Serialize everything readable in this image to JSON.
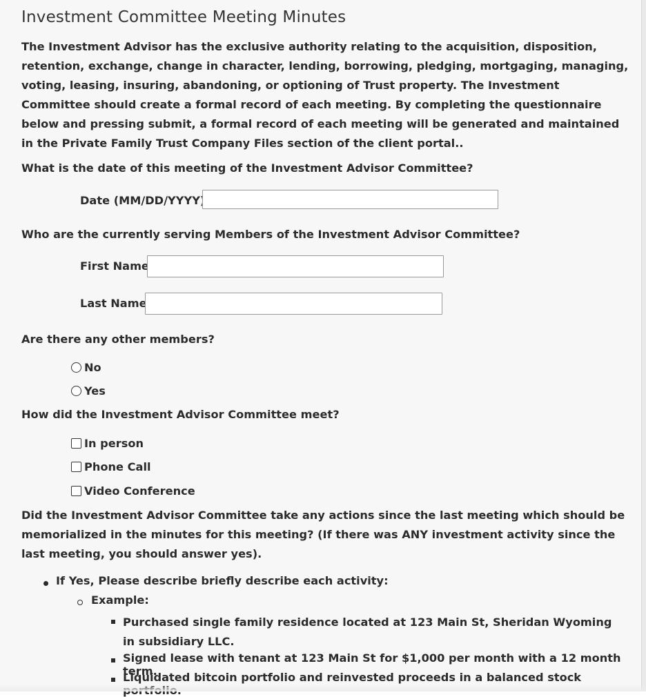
{
  "form": {
    "title": "Investment Committee Meeting Minutes",
    "intro": "The Investment Advisor has the exclusive authority relating to the acquisition, disposition, retention, exchange, change in character, lending, borrowing, pledging, mortgaging, managing, voting, leasing, insuring, abandoning, or optioning of Trust property. The Investment Committee should create a formal record of each meeting. By completing the questionnaire below and pressing submit, a formal record of each meeting will be generated and maintained in the Private Family Trust Company Files section of the client portal..",
    "date_question": "What is the date of this meeting of the Investment Advisor Committee?",
    "date_label": "Date (MM/DD/YYYY):",
    "date_value": "",
    "members_question": "Who are the currently serving Members of the Investment Advisor Committee?",
    "first_name_label": "First Name",
    "first_name_value": "",
    "last_name_label": "Last Name",
    "last_name_value": "",
    "other_members_question": "Are there any other members?",
    "other_members_options": [
      {
        "label": "No",
        "selected": false
      },
      {
        "label": "Yes",
        "selected": false
      }
    ],
    "meet_question": "How did the Investment Advisor Committee meet?",
    "meet_options": [
      {
        "label": "In person",
        "checked": false
      },
      {
        "label": "Phone Call",
        "checked": false
      },
      {
        "label": "Video Conference",
        "checked": false
      }
    ],
    "actions_question": "Did the Investment Advisor Committee take any actions since the last meeting which should be memorialized in the minutes for this meeting? (If there was ANY investment activity since the last meeting, you should answer yes).",
    "if_yes": "If Yes, Please describe briefly describe each activity:",
    "example_label": "Example:",
    "examples": [
      "Purchased single family residence located at 123 Main St, Sheridan Wyoming in subsidiary LLC.",
      "Signed lease with tenant at 123 Main St for $1,000 per month with a 12 month term.",
      "Liquidated bitcoin portfolio and reinvested proceeds in a balanced stock portfolio."
    ]
  }
}
